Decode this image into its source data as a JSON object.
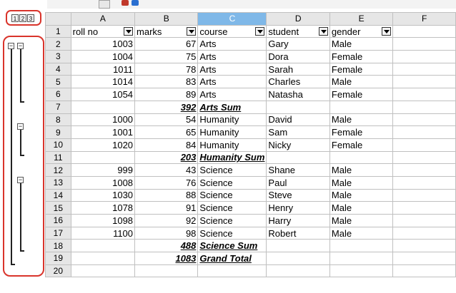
{
  "outline_levels": [
    "1",
    "2",
    "3"
  ],
  "columns": {
    "corner": "",
    "A": "A",
    "B": "B",
    "C": "C",
    "D": "D",
    "E": "E",
    "F": "F"
  },
  "header_row": {
    "num": "1",
    "A": "roll no",
    "B": "marks",
    "C": "course",
    "D": "student",
    "E": "gender"
  },
  "rows": [
    {
      "num": "2",
      "A": "1003",
      "B": "67",
      "C": "Arts",
      "D": "Gary",
      "E": "Male"
    },
    {
      "num": "3",
      "A": "1004",
      "B": "75",
      "C": "Arts",
      "D": "Dora",
      "E": "Female"
    },
    {
      "num": "4",
      "A": "1011",
      "B": "78",
      "C": "Arts",
      "D": "Sarah",
      "E": "Female"
    },
    {
      "num": "5",
      "A": "1014",
      "B": "83",
      "C": "Arts",
      "D": "Charles",
      "E": "Male"
    },
    {
      "num": "6",
      "A": "1054",
      "B": "89",
      "C": "Arts",
      "D": "Natasha",
      "E": "Female"
    },
    {
      "num": "7",
      "A": "",
      "B": "392",
      "C": "Arts Sum",
      "D": "",
      "E": "",
      "sum": true
    },
    {
      "num": "8",
      "A": "1000",
      "B": "54",
      "C": "Humanity",
      "D": "David",
      "E": "Male"
    },
    {
      "num": "9",
      "A": "1001",
      "B": "65",
      "C": "Humanity",
      "D": "Sam",
      "E": "Female"
    },
    {
      "num": "10",
      "A": "1020",
      "B": "84",
      "C": "Humanity",
      "D": "Nicky",
      "E": "Female"
    },
    {
      "num": "11",
      "A": "",
      "B": "203",
      "C": "Humanity Sum",
      "D": "",
      "E": "",
      "sum": true
    },
    {
      "num": "12",
      "A": "999",
      "B": "43",
      "C": "Science",
      "D": "Shane",
      "E": "Male"
    },
    {
      "num": "13",
      "A": "1008",
      "B": "76",
      "C": "Science",
      "D": "Paul",
      "E": "Male"
    },
    {
      "num": "14",
      "A": "1030",
      "B": "88",
      "C": "Science",
      "D": "Steve",
      "E": "Male"
    },
    {
      "num": "15",
      "A": "1078",
      "B": "91",
      "C": "Science",
      "D": "Henry",
      "E": "Male"
    },
    {
      "num": "16",
      "A": "1098",
      "B": "92",
      "C": "Science",
      "D": "Harry",
      "E": "Male"
    },
    {
      "num": "17",
      "A": "1100",
      "B": "98",
      "C": "Science",
      "D": "Robert",
      "E": "Male"
    },
    {
      "num": "18",
      "A": "",
      "B": "488",
      "C": "Science Sum",
      "D": "",
      "E": "",
      "sum": true
    },
    {
      "num": "19",
      "A": "",
      "B": "1083",
      "C": "Grand Total",
      "D": "",
      "E": "",
      "sum": true
    },
    {
      "num": "20",
      "A": "",
      "B": "",
      "C": "",
      "D": "",
      "E": ""
    }
  ],
  "colors": {
    "highlight": "#d9342b",
    "selected_column": "#7fb8e8",
    "header_bg": "#e6e6e6"
  }
}
